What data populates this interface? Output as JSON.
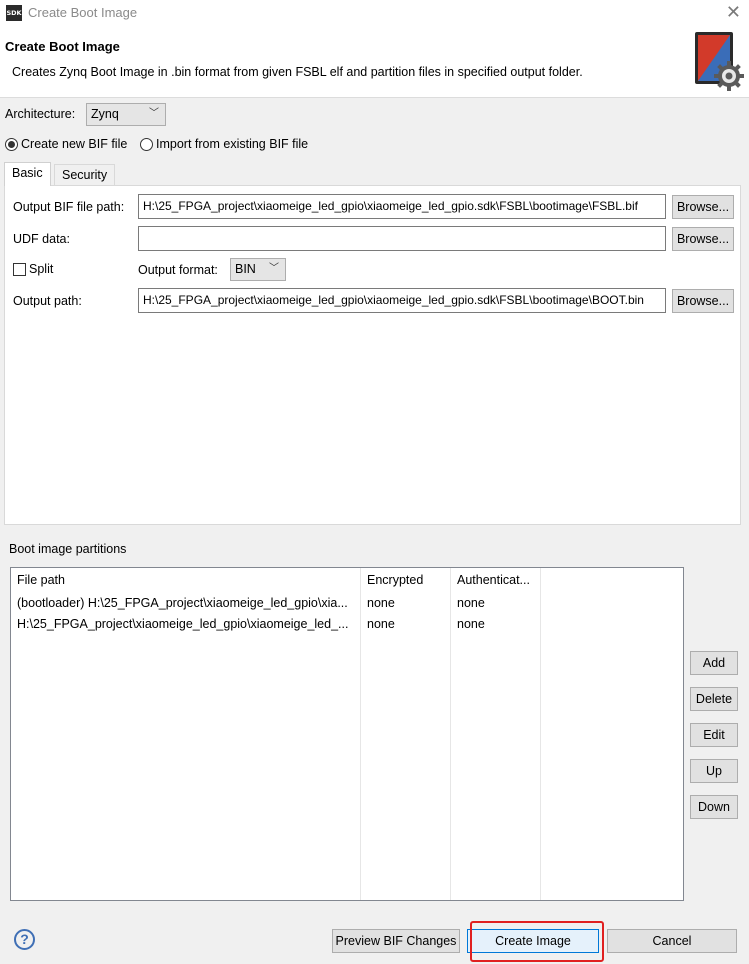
{
  "window": {
    "title": "Create Boot Image",
    "app_badge": "SDK"
  },
  "header": {
    "title": "Create Boot Image",
    "description": "Creates Zynq Boot Image in .bin format from given FSBL elf and partition files in specified output folder."
  },
  "architecture": {
    "label": "Architecture:",
    "value": "Zynq"
  },
  "bif_mode": {
    "create_new": "Create new BIF file",
    "import_existing": "Import from existing BIF file",
    "selected": "create_new"
  },
  "tabs": [
    {
      "label": "Basic",
      "active": true
    },
    {
      "label": "Security",
      "active": false
    }
  ],
  "basic": {
    "output_bif_label": "Output BIF file path:",
    "output_bif_value": "H:\\25_FPGA_project\\xiaomeige_led_gpio\\xiaomeige_led_gpio.sdk\\FSBL\\bootimage\\FSBL.bif",
    "udf_label": "UDF data:",
    "udf_value": "",
    "split_label": "Split",
    "split_checked": false,
    "output_format_label": "Output format:",
    "output_format_value": "BIN",
    "output_path_label": "Output path:",
    "output_path_value": "H:\\25_FPGA_project\\xiaomeige_led_gpio\\xiaomeige_led_gpio.sdk\\FSBL\\bootimage\\BOOT.bin",
    "browse_label": "Browse..."
  },
  "partitions": {
    "group_label": "Boot image partitions",
    "columns": [
      "File path",
      "Encrypted",
      "Authenticat..."
    ],
    "rows": [
      [
        "(bootloader) H:\\25_FPGA_project\\xiaomeige_led_gpio\\xia...",
        "none",
        "none"
      ],
      [
        "H:\\25_FPGA_project\\xiaomeige_led_gpio\\xiaomeige_led_...",
        "none",
        "none"
      ]
    ],
    "buttons": {
      "add": "Add",
      "delete": "Delete",
      "edit": "Edit",
      "up": "Up",
      "down": "Down"
    }
  },
  "footer": {
    "help_glyph": "?",
    "preview": "Preview BIF Changes",
    "create": "Create Image",
    "cancel": "Cancel"
  },
  "colors": {
    "accent_border": "#0078d7",
    "highlight_box": "#e02020"
  }
}
